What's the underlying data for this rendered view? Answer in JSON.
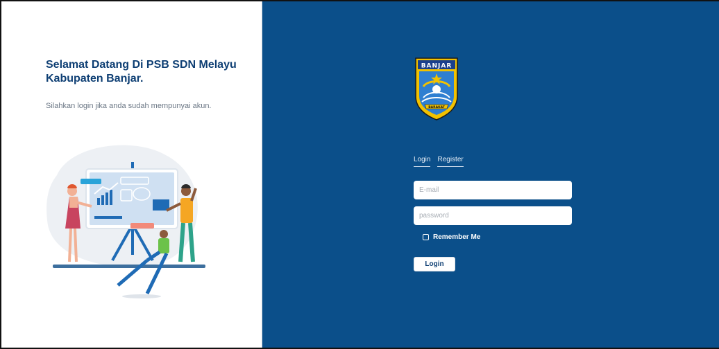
{
  "welcome": {
    "title": "Selamat Datang Di PSB SDN Melayu Kabupaten Banjar.",
    "subtitle": "Silahkan login jika anda sudah mempunyai akun."
  },
  "logo": {
    "text": "BANJAR",
    "ribbon_text": "BARAKAT",
    "icon": "banjar-crest-icon"
  },
  "tabs": [
    {
      "label": "Login"
    },
    {
      "label": "Register"
    }
  ],
  "form": {
    "email_placeholder": "E-mail",
    "password_placeholder": "password",
    "remember_label": "Remember Me",
    "login_label": "Login"
  },
  "colors": {
    "panel_blue": "#0b4f8a",
    "title_navy": "#0d3e73"
  }
}
